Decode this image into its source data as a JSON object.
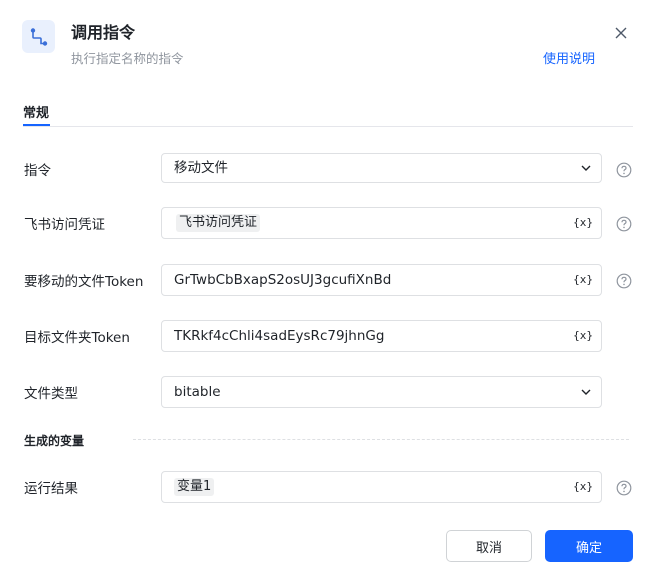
{
  "header": {
    "title": "调用指令",
    "subtitle": "执行指定名称的指令",
    "help_link": "使用说明",
    "icon": "flow-route-icon"
  },
  "tabs": [
    {
      "label": "常规",
      "active": true
    }
  ],
  "fields": [
    {
      "label": "指令",
      "value": "移动文件",
      "type": "select"
    },
    {
      "label": "飞书访问凭证",
      "value": "飞书访问凭证",
      "type": "tag-input"
    },
    {
      "label": "要移动的文件Token",
      "value": "GrTwbCbBxapS2osUJ3gcufiXnBd",
      "type": "text-input"
    },
    {
      "label": "目标文件夹Token",
      "value": "TKRkf4cChli4sadEysRc79jhnGg",
      "type": "text-input"
    },
    {
      "label": "文件类型",
      "value": "bitable",
      "type": "select"
    }
  ],
  "variable_symbol": "{x}",
  "output_section": {
    "title": "生成的变量",
    "fields": [
      {
        "label": "运行结果",
        "value": "变量1",
        "type": "tag-input"
      }
    ]
  },
  "footer": {
    "cancel_label": "取消",
    "confirm_label": "确定"
  },
  "colors": {
    "accent": "#1664ff",
    "icon_bg": "#e9f0fd"
  }
}
